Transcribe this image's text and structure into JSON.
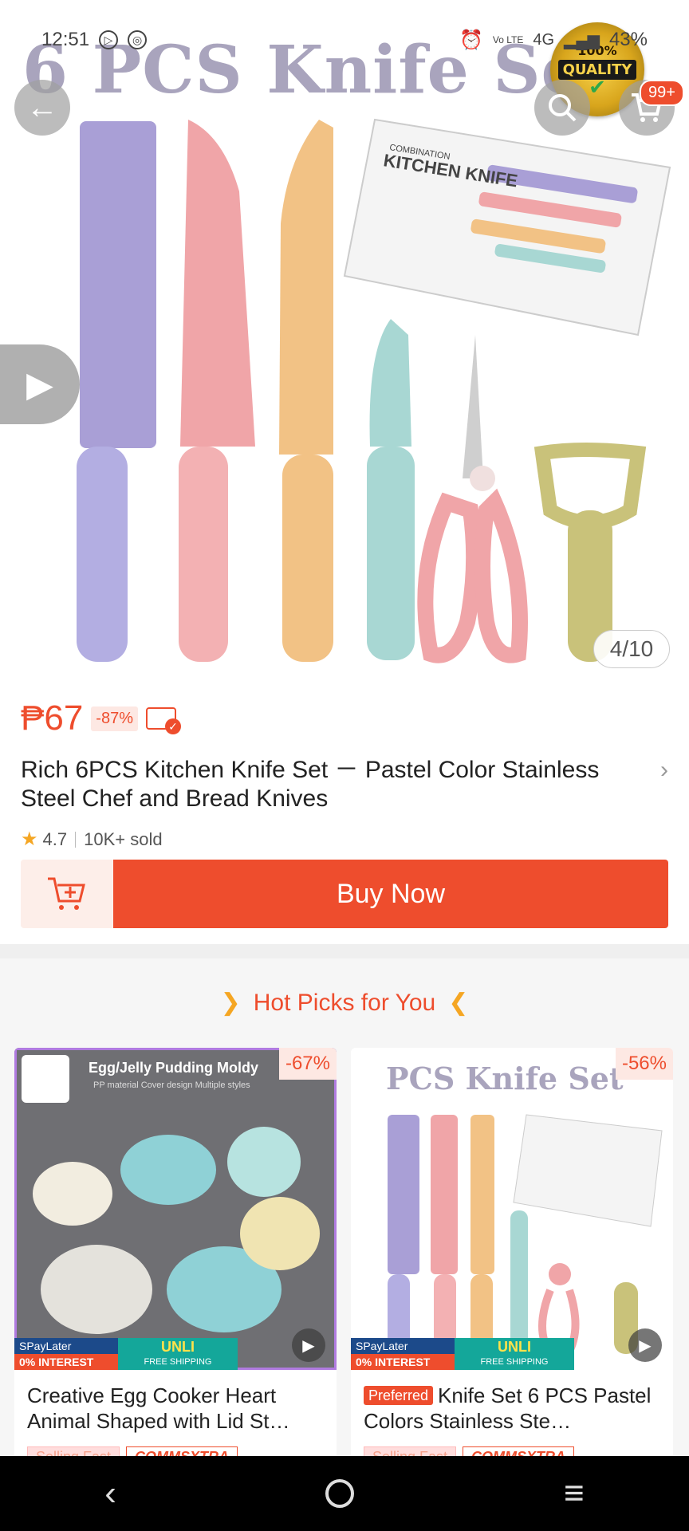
{
  "status_bar": {
    "time": "12:51",
    "network": "4G",
    "volte": "Vo LTE",
    "battery": "43%"
  },
  "hero": {
    "overlay_title": "6 PCS Knife Set",
    "badge_percent": "100%",
    "badge_text": "QUALITY",
    "box_label": "KITCHEN KNIFE",
    "box_label_small": "COMBINATION",
    "page_counter": "4/10",
    "cart_count": "99+"
  },
  "product": {
    "price": "₱67",
    "discount": "-87%",
    "title": "Rich 6PCS Kitchen Knife Set － Pastel Color Stainless Steel Chef and Bread Knives",
    "rating": "4.7",
    "sold": "10K+ sold"
  },
  "actions": {
    "buy_now": "Buy Now"
  },
  "hot_picks": {
    "title": "Hot Picks for You",
    "items": [
      {
        "image_caption": "Egg/Jelly Pudding Moldy",
        "image_subcaption": "PP material   Cover design   Multiple styles",
        "discount": "-67%",
        "name": "Creative Egg Cooker Heart Animal Shaped with Lid St…",
        "promo_spaylater": "SPayLater",
        "promo_interest": "0% INTEREST",
        "promo_unli": "UNLI",
        "promo_shipping": "FREE SHIPPING",
        "tag1": "Selling Fast",
        "tag2": "COMMSXTRA"
      },
      {
        "image_caption": "PCS Knife Set",
        "discount": "-56%",
        "preferred": "Preferred",
        "name": "Knife Set 6 PCS Pastel Colors Stainless Ste…",
        "promo_spaylater": "SPayLater",
        "promo_interest": "0% INTEREST",
        "promo_unli": "UNLI",
        "promo_shipping": "FREE SHIPPING",
        "tag1": "Selling Fast",
        "tag2": "COMMSXTRA"
      }
    ]
  },
  "colors": {
    "accent": "#ee4d2d",
    "knife_purple": "#a99fd6",
    "knife_pink": "#f0a5a8",
    "knife_orange": "#f2c285",
    "knife_blue": "#a8d7d3",
    "peeler": "#c9c27a"
  }
}
